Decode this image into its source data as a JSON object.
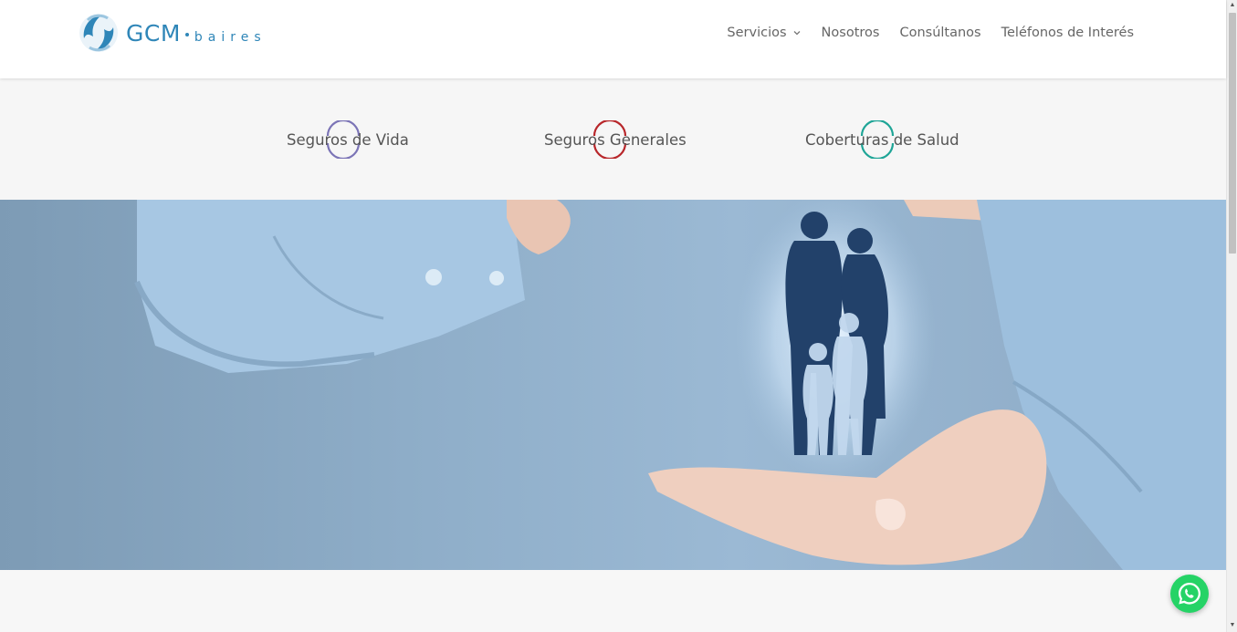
{
  "brand": {
    "name": "GCM",
    "suffix": "baires",
    "color": "#2f86b8"
  },
  "nav": {
    "items": [
      {
        "label": "Servicios",
        "has_dropdown": true
      },
      {
        "label": "Nosotros"
      },
      {
        "label": "Consúltanos"
      },
      {
        "label": "Teléfonos de Interés"
      }
    ]
  },
  "services": [
    {
      "label": "Seguros de Vida",
      "icon": "ring-icon",
      "color": "#7b74b6"
    },
    {
      "label": "Seguros Generales",
      "icon": "ring-icon",
      "color": "#b8262a"
    },
    {
      "label": "Coberturas de Salud",
      "icon": "ring-icon",
      "color": "#1fa597"
    }
  ],
  "hero": {
    "image": "hands-protecting-family-silhouette"
  },
  "whatsapp": {
    "icon": "whatsapp-icon",
    "color": "#25d366"
  }
}
